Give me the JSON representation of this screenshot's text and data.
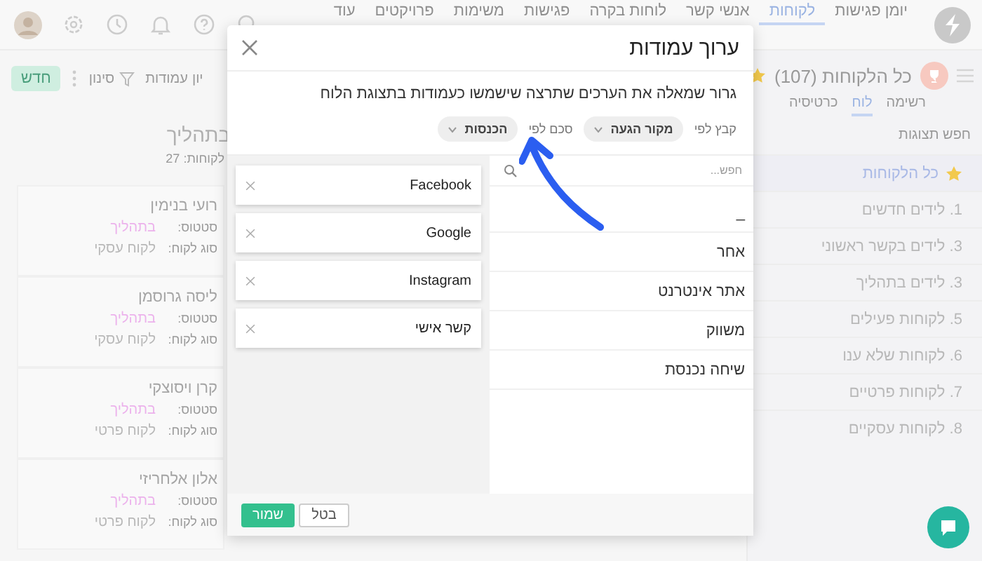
{
  "topbar": {
    "nav": [
      {
        "label": "יומן פגישות",
        "selected": false
      },
      {
        "label": "לקוחות",
        "selected": true
      },
      {
        "label": "אנשי קשר",
        "selected": false
      },
      {
        "label": "לוחות בקרה",
        "selected": false
      },
      {
        "label": "פגישות",
        "selected": false
      },
      {
        "label": "משימות",
        "selected": false
      },
      {
        "label": "פרויקטים",
        "selected": false
      },
      {
        "label": "עוד",
        "selected": false
      }
    ]
  },
  "page_header": {
    "title": "כל הלקוחות (107)",
    "favorite": true,
    "view_tabs": [
      {
        "label": "רשימה",
        "selected": false
      },
      {
        "label": "לוח",
        "selected": true
      },
      {
        "label": "כרטיסיה",
        "selected": false
      }
    ]
  },
  "toolbar": {
    "sort_label": "יון",
    "columns_label": "עמודות",
    "filter_label": "סינון",
    "new_button": "חדש"
  },
  "sidebar": {
    "search": {
      "placeholder": "חפש תצוגות"
    },
    "items": [
      {
        "label": "כל הלקוחות",
        "selected": true,
        "favorite": true
      },
      {
        "label": "1. לידים חדשים",
        "selected": false,
        "favorite": false
      },
      {
        "label": "3. לידים בקשר ראשוני",
        "selected": false,
        "favorite": false
      },
      {
        "label": "3. לידים בתהליך",
        "selected": false,
        "favorite": false
      },
      {
        "label": "5. לקוחות פעילים",
        "selected": false,
        "favorite": false
      },
      {
        "label": "6. לקוחות שלא ענו",
        "selected": false,
        "favorite": false
      },
      {
        "label": "7. לקוחות פרטיים",
        "selected": false,
        "favorite": false
      },
      {
        "label": "8. לקוחות עסקיים",
        "selected": false,
        "favorite": false
      }
    ]
  },
  "board_column": {
    "title": "בתהליך",
    "count": "לקוחות: 27",
    "cards": [
      {
        "name": "רועי בנימין",
        "status_label": "סטטוס:",
        "status": "בתהליך",
        "type_label": "סוג לקוח:",
        "type": "לקוח עסקי"
      },
      {
        "name": "ליסה גרוסמן",
        "status_label": "סטטוס:",
        "status": "בתהליך",
        "type_label": "סוג לקוח:",
        "type": "לקוח עסקי"
      },
      {
        "name": "קרן ויסוצקי",
        "status_label": "סטטוס:",
        "status": "בתהליך",
        "type_label": "סוג לקוח:",
        "type": "לקוח פרטי"
      },
      {
        "name": "אלון אלחריזי",
        "status_label": "סטטוס:",
        "status": "בתהליך",
        "type_label": "סוג לקוח:",
        "type": "לקוח פרטי"
      }
    ]
  },
  "dialog": {
    "title": "ערוך עמודות",
    "description": "גרור שמאלה את הערכים שתרצה שישמשו כעמודות בתצוגת הלוח",
    "group_by": {
      "label": "קבץ לפי",
      "value": "מקור הגעה"
    },
    "summarize_by": {
      "label": "סכם לפי",
      "value": "הכנסות"
    },
    "search": {
      "placeholder": "חפש..."
    },
    "available_values": [
      "_",
      "אחר",
      "אתר אינטרנט",
      "משווק",
      "שיחה נכנסת"
    ],
    "selected_columns": [
      "Facebook",
      "Google",
      "Instagram",
      "קשר אישי"
    ],
    "buttons": {
      "save": "שמור",
      "cancel": "בטל"
    }
  }
}
